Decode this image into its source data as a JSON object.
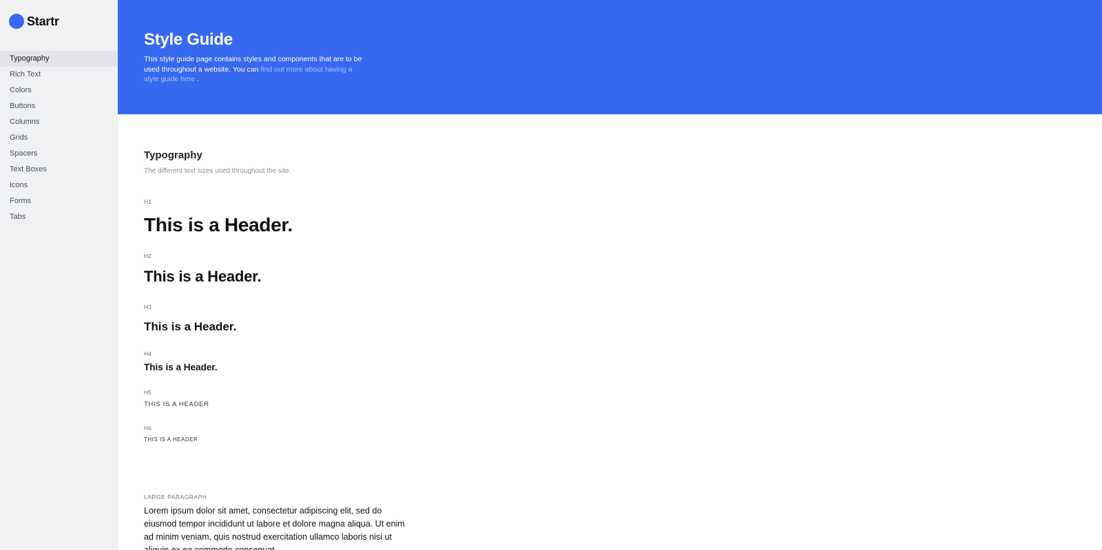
{
  "brand": {
    "name": "Startr",
    "color": "#3768f0"
  },
  "sidebar": {
    "items": [
      {
        "label": "Typography",
        "active": true
      },
      {
        "label": "Rich Text"
      },
      {
        "label": "Colors"
      },
      {
        "label": "Buttons"
      },
      {
        "label": "Columns"
      },
      {
        "label": "Grids"
      },
      {
        "label": "Spacers"
      },
      {
        "label": "Text Boxes"
      },
      {
        "label": "Icons"
      },
      {
        "label": "Forms"
      },
      {
        "label": "Tabs"
      }
    ]
  },
  "hero": {
    "title": "Style Guide",
    "desc_prefix": "This style guide page contains styles and components that are to be used throughout a website. You can ",
    "link_text": "find out more about having a style guide here",
    "desc_suffix": " .",
    "background": "#3768f0"
  },
  "typography": {
    "title": "Typography",
    "subtitle": "The different text sizes used throughout the site.",
    "h1": {
      "tag": "H1",
      "text": "This is a Header."
    },
    "h2": {
      "tag": "H2",
      "text": "This is a Header."
    },
    "h3": {
      "tag": "H3",
      "text": "This is a Header."
    },
    "h4": {
      "tag": "H4",
      "text": "This is a Header."
    },
    "h5": {
      "tag": "H5",
      "text": "THIS IS A HEADER"
    },
    "h6": {
      "tag": "H6",
      "text": "THIS IS A HEADER"
    },
    "large_paragraph": {
      "label": "LARGE PARAGRAPH",
      "text": "Lorem ipsum dolor sit amet, consectetur adipiscing elit, sed do eiusmod tempor incididunt ut labore et dolore magna aliqua. Ut enim ad minim veniam, quis nostrud exercitation ullamco laboris nisi ut aliquip ex ea commodo consequat."
    }
  }
}
